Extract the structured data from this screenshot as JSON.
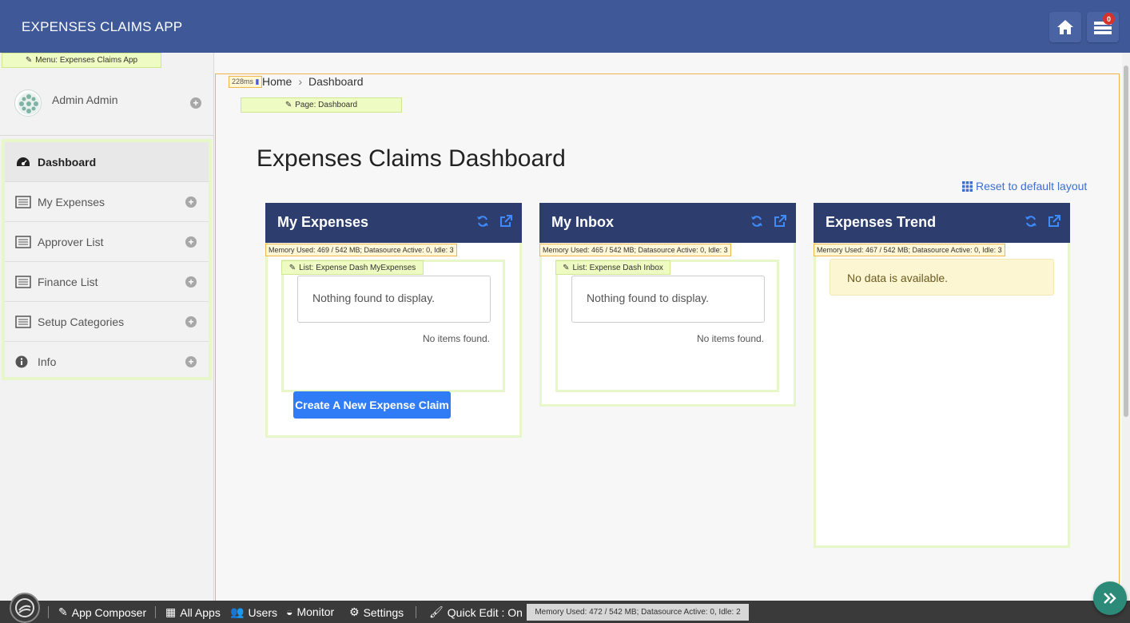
{
  "app": {
    "title": "EXPENSES CLAIMS APP",
    "notification_count": "0"
  },
  "sidebar": {
    "menu_tag": "Menu: Expenses Claims App",
    "user_name": "Admin Admin",
    "items": [
      {
        "label": "Dashboard",
        "icon": "dashboard-icon",
        "active": true
      },
      {
        "label": "My Expenses",
        "icon": "list-icon"
      },
      {
        "label": "Approver List",
        "icon": "list-icon"
      },
      {
        "label": "Finance List",
        "icon": "list-icon"
      },
      {
        "label": "Setup Categories",
        "icon": "list-icon"
      },
      {
        "label": "Info",
        "icon": "info-icon"
      }
    ]
  },
  "main": {
    "timing": "228ms",
    "breadcrumb": {
      "home": "Home",
      "current": "Dashboard"
    },
    "page_tag": "Page: Dashboard",
    "page_title": "Expenses Claims Dashboard",
    "reset_link": "Reset to default layout",
    "panels": [
      {
        "title": "My Expenses",
        "memory": "Memory Used: 469 / 542 MB; Datasource Active: 0, Idle: 3",
        "list_tag": "List: Expense Dash MyExpenses",
        "empty_text": "Nothing found to display.",
        "no_items": "No items found.",
        "button": "Create A New Expense Claim"
      },
      {
        "title": "My Inbox",
        "memory": "Memory Used: 465 / 542 MB; Datasource Active: 0, Idle: 3",
        "list_tag": "List: Expense Dash Inbox",
        "empty_text": "Nothing found to display.",
        "no_items": "No items found."
      },
      {
        "title": "Expenses Trend",
        "memory": "Memory Used: 467 / 542 MB; Datasource Active: 0, Idle: 3",
        "no_data": "No data is available."
      }
    ]
  },
  "bottombar": {
    "app_composer": "App Composer",
    "all_apps": "All Apps",
    "users": "Users",
    "monitor": "Monitor",
    "settings": "Settings",
    "quick_edit": "Quick Edit : On",
    "memory": "Memory Used: 472 / 542 MB; Datasource Active: 0, Idle: 2"
  },
  "colors": {
    "topbar": "#3f5998",
    "panel_header": "#2d3e6e",
    "accent": "#2f7cf6",
    "edit_highlight": "#e8f7c9"
  }
}
